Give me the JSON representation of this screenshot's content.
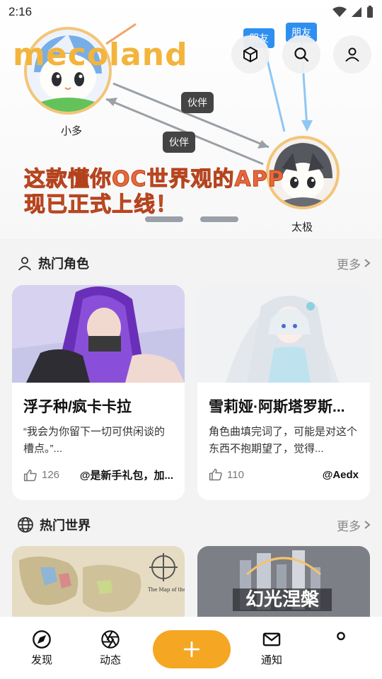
{
  "status_bar": {
    "time": "2:16"
  },
  "banner": {
    "brand": "mecoland",
    "char_left": "小多",
    "char_right": "太极",
    "relations": [
      "伙伴",
      "伙伴"
    ],
    "friend_tags": [
      "朋友",
      "朋友"
    ],
    "slogan_line1": "这款懂你OC世界观的APP",
    "slogan_line2": "现已正式上线！",
    "page_dots": 2
  },
  "top_actions": [
    {
      "icon": "cube-icon"
    },
    {
      "icon": "search-icon"
    },
    {
      "icon": "user-icon"
    }
  ],
  "hot_characters": {
    "title": "热门角色",
    "more": "更多",
    "cards": [
      {
        "title": "浮子种/疯卡卡拉",
        "desc": "“我会为你留下一切可供闲谈的槽点。”...",
        "likes": "126",
        "author": "@是新手礼包，加..."
      },
      {
        "title": "雪莉娅·阿斯塔罗斯...",
        "desc": "角色曲填完词了，可能是对这个东西不抱期望了，觉得...",
        "likes": "110",
        "author": "@Aedx"
      }
    ]
  },
  "hot_worlds": {
    "title": "热门世界",
    "more": "更多",
    "cards": [
      {
        "image_text": "The Map of the Westlands"
      },
      {
        "image_text": "幻光涅槃"
      }
    ]
  },
  "bottom_nav": {
    "discover": "发现",
    "feed": "动态",
    "notify": "通知",
    "profile": ""
  },
  "colors": {
    "accent": "#f5a623",
    "logo": "#f3b43c",
    "slogan": "#e8683a",
    "friend_tag": "#2e8ff0"
  }
}
